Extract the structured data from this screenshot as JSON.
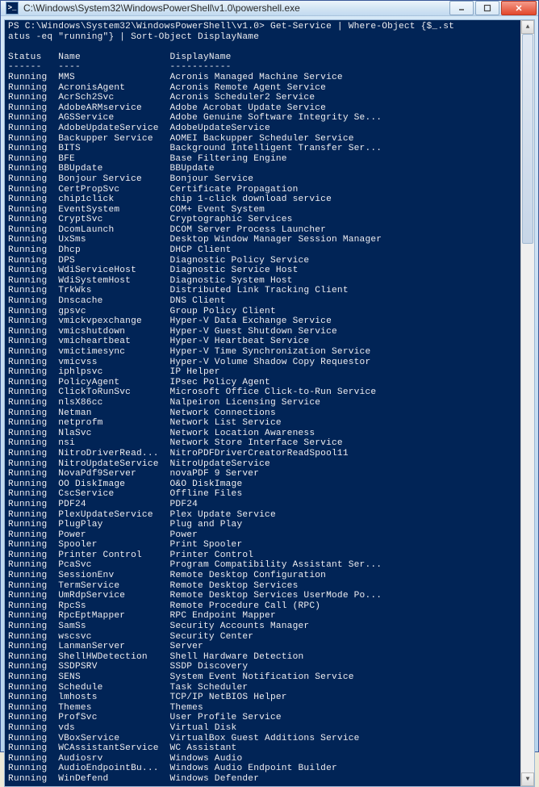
{
  "window": {
    "title": "C:\\Windows\\System32\\WindowsPowerShell\\v1.0\\powershell.exe",
    "icon_label": ">_"
  },
  "prompt": {
    "line1": "PS C:\\Windows\\System32\\WindowsPowerShell\\v1.0> Get-Service | Where-Object {$_.st",
    "line2": "atus -eq \"running\"} | Sort-Object DisplayName"
  },
  "columns": {
    "c1": "Status",
    "c2": "Name",
    "c3": "DisplayName",
    "u1": "------",
    "u2": "----",
    "u3": "-----------"
  },
  "rows": [
    {
      "status": "Running",
      "name": "MMS",
      "disp": "Acronis Managed Machine Service"
    },
    {
      "status": "Running",
      "name": "AcronisAgent",
      "disp": "Acronis Remote Agent Service"
    },
    {
      "status": "Running",
      "name": "AcrSch2Svc",
      "disp": "Acronis Scheduler2 Service"
    },
    {
      "status": "Running",
      "name": "AdobeARMservice",
      "disp": "Adobe Acrobat Update Service"
    },
    {
      "status": "Running",
      "name": "AGSService",
      "disp": "Adobe Genuine Software Integrity Se..."
    },
    {
      "status": "Running",
      "name": "AdobeUpdateService",
      "disp": "AdobeUpdateService"
    },
    {
      "status": "Running",
      "name": "Backupper Service",
      "disp": "AOMEI Backupper Scheduler Service"
    },
    {
      "status": "Running",
      "name": "BITS",
      "disp": "Background Intelligent Transfer Ser..."
    },
    {
      "status": "Running",
      "name": "BFE",
      "disp": "Base Filtering Engine"
    },
    {
      "status": "Running",
      "name": "BBUpdate",
      "disp": "BBUpdate"
    },
    {
      "status": "Running",
      "name": "Bonjour Service",
      "disp": "Bonjour Service"
    },
    {
      "status": "Running",
      "name": "CertPropSvc",
      "disp": "Certificate Propagation"
    },
    {
      "status": "Running",
      "name": "chip1click",
      "disp": "chip 1-click download service"
    },
    {
      "status": "Running",
      "name": "EventSystem",
      "disp": "COM+ Event System"
    },
    {
      "status": "Running",
      "name": "CryptSvc",
      "disp": "Cryptographic Services"
    },
    {
      "status": "Running",
      "name": "DcomLaunch",
      "disp": "DCOM Server Process Launcher"
    },
    {
      "status": "Running",
      "name": "UxSms",
      "disp": "Desktop Window Manager Session Manager"
    },
    {
      "status": "Running",
      "name": "Dhcp",
      "disp": "DHCP Client"
    },
    {
      "status": "Running",
      "name": "DPS",
      "disp": "Diagnostic Policy Service"
    },
    {
      "status": "Running",
      "name": "WdiServiceHost",
      "disp": "Diagnostic Service Host"
    },
    {
      "status": "Running",
      "name": "WdiSystemHost",
      "disp": "Diagnostic System Host"
    },
    {
      "status": "Running",
      "name": "TrkWks",
      "disp": "Distributed Link Tracking Client"
    },
    {
      "status": "Running",
      "name": "Dnscache",
      "disp": "DNS Client"
    },
    {
      "status": "Running",
      "name": "gpsvc",
      "disp": "Group Policy Client"
    },
    {
      "status": "Running",
      "name": "vmickvpexchange",
      "disp": "Hyper-V Data Exchange Service"
    },
    {
      "status": "Running",
      "name": "vmicshutdown",
      "disp": "Hyper-V Guest Shutdown Service"
    },
    {
      "status": "Running",
      "name": "vmicheartbeat",
      "disp": "Hyper-V Heartbeat Service"
    },
    {
      "status": "Running",
      "name": "vmictimesync",
      "disp": "Hyper-V Time Synchronization Service"
    },
    {
      "status": "Running",
      "name": "vmicvss",
      "disp": "Hyper-V Volume Shadow Copy Requestor"
    },
    {
      "status": "Running",
      "name": "iphlpsvc",
      "disp": "IP Helper"
    },
    {
      "status": "Running",
      "name": "PolicyAgent",
      "disp": "IPsec Policy Agent"
    },
    {
      "status": "Running",
      "name": "ClickToRunSvc",
      "disp": "Microsoft Office Click-to-Run Service"
    },
    {
      "status": "Running",
      "name": "nlsX86cc",
      "disp": "Nalpeiron Licensing Service"
    },
    {
      "status": "Running",
      "name": "Netman",
      "disp": "Network Connections"
    },
    {
      "status": "Running",
      "name": "netprofm",
      "disp": "Network List Service"
    },
    {
      "status": "Running",
      "name": "NlaSvc",
      "disp": "Network Location Awareness"
    },
    {
      "status": "Running",
      "name": "nsi",
      "disp": "Network Store Interface Service"
    },
    {
      "status": "Running",
      "name": "NitroDriverRead...",
      "disp": "NitroPDFDriverCreatorReadSpool11"
    },
    {
      "status": "Running",
      "name": "NitroUpdateService",
      "disp": "NitroUpdateService"
    },
    {
      "status": "Running",
      "name": "NovaPdf9Server",
      "disp": "novaPDF 9 Server"
    },
    {
      "status": "Running",
      "name": "OO DiskImage",
      "disp": "O&O DiskImage"
    },
    {
      "status": "Running",
      "name": "CscService",
      "disp": "Offline Files"
    },
    {
      "status": "Running",
      "name": "PDF24",
      "disp": "PDF24"
    },
    {
      "status": "Running",
      "name": "PlexUpdateService",
      "disp": "Plex Update Service"
    },
    {
      "status": "Running",
      "name": "PlugPlay",
      "disp": "Plug and Play"
    },
    {
      "status": "Running",
      "name": "Power",
      "disp": "Power"
    },
    {
      "status": "Running",
      "name": "Spooler",
      "disp": "Print Spooler"
    },
    {
      "status": "Running",
      "name": "Printer Control",
      "disp": "Printer Control"
    },
    {
      "status": "Running",
      "name": "PcaSvc",
      "disp": "Program Compatibility Assistant Ser..."
    },
    {
      "status": "Running",
      "name": "SessionEnv",
      "disp": "Remote Desktop Configuration"
    },
    {
      "status": "Running",
      "name": "TermService",
      "disp": "Remote Desktop Services"
    },
    {
      "status": "Running",
      "name": "UmRdpService",
      "disp": "Remote Desktop Services UserMode Po..."
    },
    {
      "status": "Running",
      "name": "RpcSs",
      "disp": "Remote Procedure Call (RPC)"
    },
    {
      "status": "Running",
      "name": "RpcEptMapper",
      "disp": "RPC Endpoint Mapper"
    },
    {
      "status": "Running",
      "name": "SamSs",
      "disp": "Security Accounts Manager"
    },
    {
      "status": "Running",
      "name": "wscsvc",
      "disp": "Security Center"
    },
    {
      "status": "Running",
      "name": "LanmanServer",
      "disp": "Server"
    },
    {
      "status": "Running",
      "name": "ShellHWDetection",
      "disp": "Shell Hardware Detection"
    },
    {
      "status": "Running",
      "name": "SSDPSRV",
      "disp": "SSDP Discovery"
    },
    {
      "status": "Running",
      "name": "SENS",
      "disp": "System Event Notification Service"
    },
    {
      "status": "Running",
      "name": "Schedule",
      "disp": "Task Scheduler"
    },
    {
      "status": "Running",
      "name": "lmhosts",
      "disp": "TCP/IP NetBIOS Helper"
    },
    {
      "status": "Running",
      "name": "Themes",
      "disp": "Themes"
    },
    {
      "status": "Running",
      "name": "ProfSvc",
      "disp": "User Profile Service"
    },
    {
      "status": "Running",
      "name": "vds",
      "disp": "Virtual Disk"
    },
    {
      "status": "Running",
      "name": "VBoxService",
      "disp": "VirtualBox Guest Additions Service"
    },
    {
      "status": "Running",
      "name": "WCAssistantService",
      "disp": "WC Assistant"
    },
    {
      "status": "Running",
      "name": "Audiosrv",
      "disp": "Windows Audio"
    },
    {
      "status": "Running",
      "name": "AudioEndpointBu...",
      "disp": "Windows Audio Endpoint Builder"
    },
    {
      "status": "Running",
      "name": "WinDefend",
      "disp": "Windows Defender"
    }
  ]
}
